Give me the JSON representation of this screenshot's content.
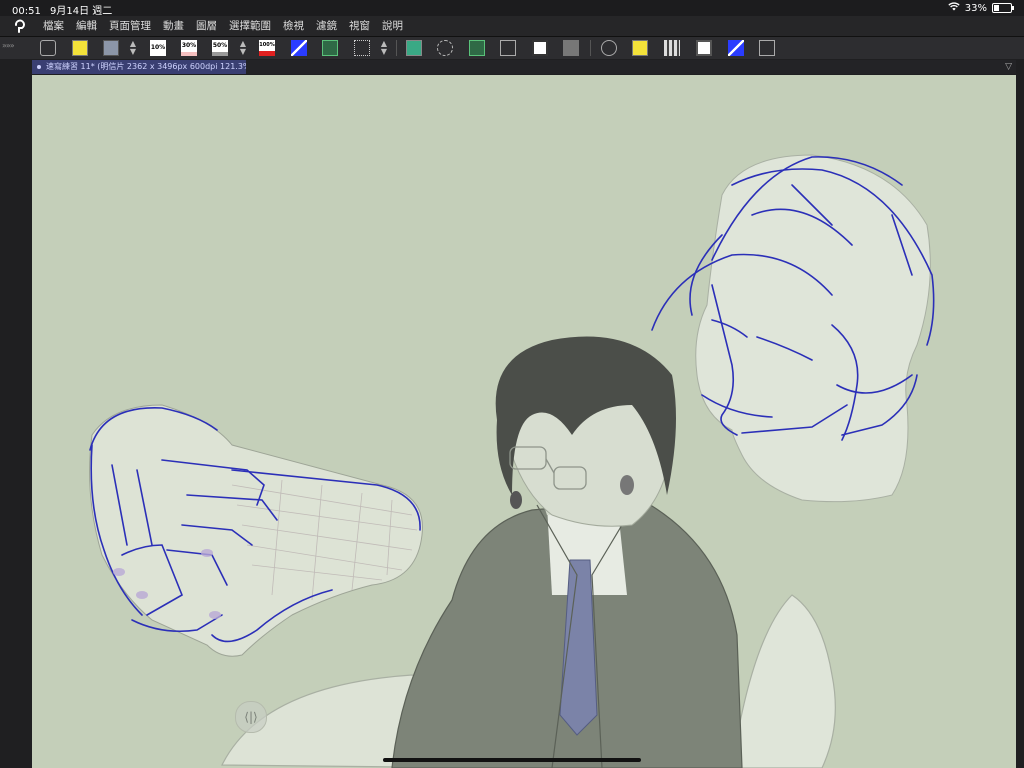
{
  "status": {
    "time": "00:51",
    "date": "9月14日 週二",
    "battery": "33%",
    "battery_level": 0.33
  },
  "menu": {
    "items": [
      "檔案",
      "編輯",
      "頁面管理",
      "動畫",
      "圖層",
      "選擇範圍",
      "檢視",
      "濾鏡",
      "視窗",
      "說明"
    ]
  },
  "command_bar": {
    "percent_labels": [
      "10%",
      "30%",
      "50%",
      "100%"
    ]
  },
  "tab": {
    "title": "速寫練習 11* (明信片 2362 x 3496px 600dpi 121.3%)"
  },
  "colors": {
    "canvas": "#c4cfb9",
    "line": "#2b2fb8",
    "tab": "#3a3f72"
  }
}
